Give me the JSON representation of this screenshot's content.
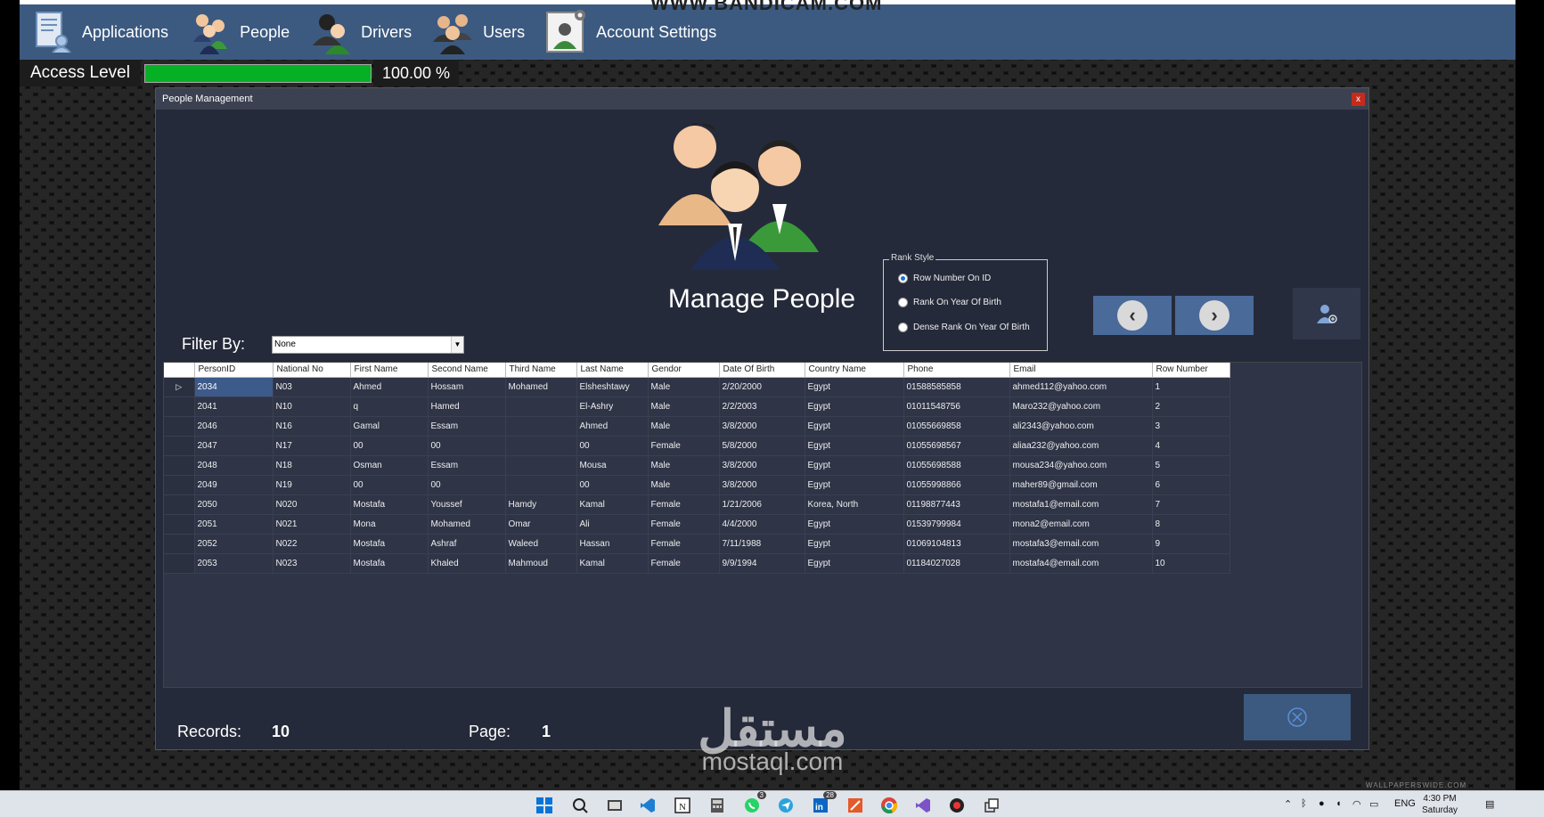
{
  "recorder_watermark": "WWW.BANDICAM.COM",
  "menu": [
    {
      "id": "applications",
      "label": "Applications",
      "icon": "applications-icon"
    },
    {
      "id": "people",
      "label": "People",
      "icon": "people-icon"
    },
    {
      "id": "drivers",
      "label": "Drivers",
      "icon": "drivers-icon"
    },
    {
      "id": "users",
      "label": "Users",
      "icon": "users-icon"
    },
    {
      "id": "account-settings",
      "label": "Account Settings",
      "icon": "account-settings-icon"
    }
  ],
  "access": {
    "label": "Access Level",
    "value_text": "100.00 %",
    "progress": 1.0,
    "bar_color": "#06b025"
  },
  "window": {
    "title": "People Management",
    "close_label": "x",
    "heading": "Manage People",
    "rank_style": {
      "legend": "Rank Style",
      "options": [
        {
          "label": "Row Number On ID",
          "selected": true
        },
        {
          "label": "Rank On Year Of Birth",
          "selected": false
        },
        {
          "label": "Dense Rank On Year Of Birth",
          "selected": false
        }
      ]
    },
    "filter": {
      "label": "Filter By:",
      "value": "None"
    },
    "table": {
      "columns": [
        "PersonID",
        "National No",
        "First Name",
        "Second Name",
        "Third Name",
        "Last Name",
        "Gendor",
        "Date Of Birth",
        "Country Name",
        "Phone",
        "Email",
        "Row Number"
      ],
      "rows": [
        [
          "2034",
          "N03",
          "Ahmed",
          "Hossam",
          "Mohamed",
          "Elsheshtawy",
          "Male",
          "2/20/2000",
          "Egypt",
          "01588585858",
          "ahmed112@yahoo.com",
          "1"
        ],
        [
          "2041",
          "N10",
          "q",
          "Hamed",
          "",
          "El-Ashry",
          "Male",
          "2/2/2003",
          "Egypt",
          "01011548756",
          "Maro232@yahoo.com",
          "2"
        ],
        [
          "2046",
          "N16",
          "Gamal",
          "Essam",
          "",
          "Ahmed",
          "Male",
          "3/8/2000",
          "Egypt",
          "01055669858",
          "ali2343@yahoo.com",
          "3"
        ],
        [
          "2047",
          "N17",
          "00",
          "00",
          "",
          "00",
          "Female",
          "5/8/2000",
          "Egypt",
          "01055698567",
          "aliaa232@yahoo.com",
          "4"
        ],
        [
          "2048",
          "N18",
          "Osman",
          "Essam",
          "",
          "Mousa",
          "Male",
          "3/8/2000",
          "Egypt",
          "01055698588",
          "mousa234@yahoo.com",
          "5"
        ],
        [
          "2049",
          "N19",
          "00",
          "00",
          "",
          "00",
          "Male",
          "3/8/2000",
          "Egypt",
          "01055998866",
          "maher89@gmail.com",
          "6"
        ],
        [
          "2050",
          "N020",
          "Mostafa",
          "Youssef",
          "Hamdy",
          "Kamal",
          "Female",
          "1/21/2006",
          "Korea, North",
          "01198877443",
          "mostafa1@email.com",
          "7"
        ],
        [
          "2051",
          "N021",
          "Mona",
          "Mohamed",
          "Omar",
          "Ali",
          "Female",
          "4/4/2000",
          "Egypt",
          "01539799984",
          "mona2@email.com",
          "8"
        ],
        [
          "2052",
          "N022",
          "Mostafa",
          "Ashraf",
          "Waleed",
          "Hassan",
          "Female",
          "7/11/1988",
          "Egypt",
          "01069104813",
          "mostafa3@email.com",
          "9"
        ],
        [
          "2053",
          "N023",
          "Mostafa",
          "Khaled",
          "Mahmoud",
          "Kamal",
          "Female",
          "9/9/1994",
          "Egypt",
          "01184027028",
          "mostafa4@email.com",
          "10"
        ]
      ]
    },
    "records_label": "Records:",
    "records_value": "10",
    "page_label": "Page:",
    "page_value": "1"
  },
  "watermark": {
    "arabic": "مستقل",
    "latin": "mostaql.com"
  },
  "wallpaper_mark": "WALLPAPERSWIDE.COM",
  "taskbar": {
    "badges": {
      "whatsapp": "3",
      "linkedin": "28"
    },
    "language": "ENG",
    "time": "4:30 PM",
    "day": "Saturday"
  }
}
